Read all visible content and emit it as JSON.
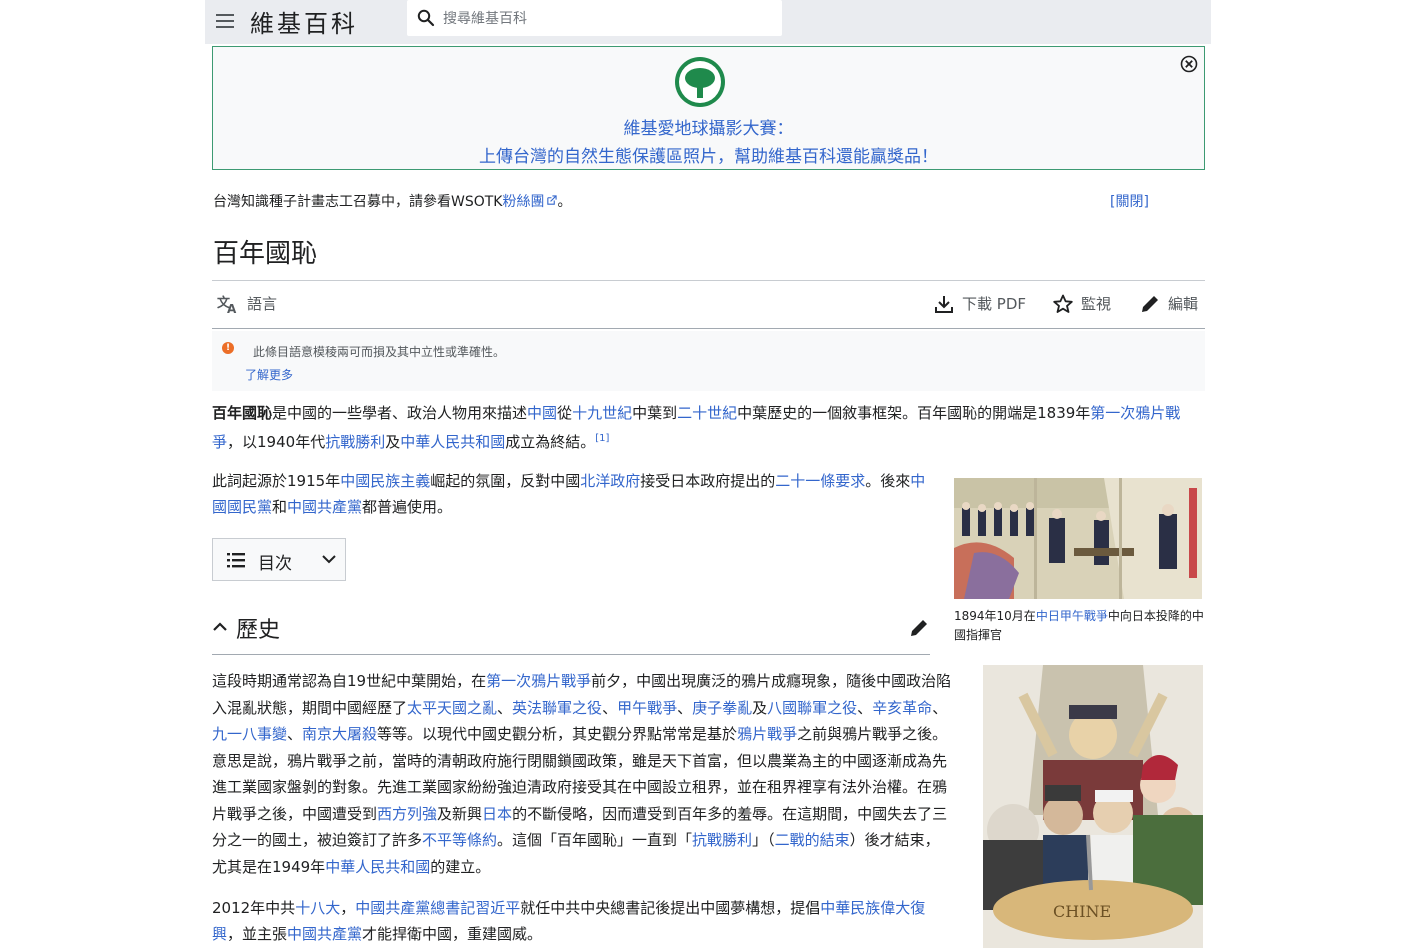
{
  "header": {
    "logo": "維基百科",
    "search_placeholder": "搜尋維基百科"
  },
  "banner": {
    "line1": "維基愛地球攝影大賽：",
    "line2": "上傳台灣的自然生態保護區照片，幫助維基百科還能贏獎品！"
  },
  "site_notice": {
    "text_before": "台灣知識種子計畫志工召募中，請參看WSOTK",
    "link": "粉絲團",
    "text_after": "。",
    "close_label": "[關閉]"
  },
  "page": {
    "title": "百年國恥"
  },
  "toolbar": {
    "language": "語言",
    "download": "下載 PDF",
    "watch": "監視",
    "edit": "編輯"
  },
  "warning": {
    "text": "此條目語意模稜兩可而損及其中立性或準確性。",
    "more": "了解更多"
  },
  "toc": {
    "label": "目次"
  },
  "section": {
    "heading": "歷史"
  },
  "figure1": {
    "caption_before": "1894年10月在",
    "caption_link": "中日甲午戰爭",
    "caption_after": "中向日本投降的中國指揮官"
  },
  "colors": {
    "link": "#3366cc",
    "banner_border": "#3d9a72",
    "header_bg": "#eaecf0",
    "warning_icon": "#ec6e27"
  },
  "paragraphs": {
    "p1": [
      {
        "t": "百年國恥",
        "b": true
      },
      {
        "t": "是中國的一些學者、政治人物用來描述"
      },
      {
        "t": "中國",
        "l": true
      },
      {
        "t": "從"
      },
      {
        "t": "十九世紀",
        "l": true
      },
      {
        "t": "中葉到"
      },
      {
        "t": "二十世紀",
        "l": true
      },
      {
        "t": "中葉歷史的一個敘事框架。百年國恥的開端是1839年"
      },
      {
        "t": "第一次鴉片戰爭",
        "l": true
      },
      {
        "t": "，以1940年代"
      },
      {
        "t": "抗戰勝利",
        "l": true
      },
      {
        "t": "及"
      },
      {
        "t": "中華人民共和國",
        "l": true
      },
      {
        "t": "成立為終結。"
      },
      {
        "t": "[1]",
        "l": true,
        "sup": true
      }
    ],
    "p2": [
      {
        "t": "此詞起源於1915年"
      },
      {
        "t": "中國民族主義",
        "l": true
      },
      {
        "t": "崛起的氛圍，反對中國"
      },
      {
        "t": "北洋政府",
        "l": true
      },
      {
        "t": "接受日本政府提出的"
      },
      {
        "t": "二十一條要求",
        "l": true
      },
      {
        "t": "。後來"
      },
      {
        "t": "中國國民黨",
        "l": true
      },
      {
        "t": "和"
      },
      {
        "t": "中國共產黨",
        "l": true
      },
      {
        "t": "都普遍使用。"
      }
    ],
    "p3": [
      {
        "t": "這段時期通常認為自19世紀中葉開始，在"
      },
      {
        "t": "第一次鴉片戰爭",
        "l": true
      },
      {
        "t": "前夕，中國出現廣泛的鴉片成癮現象，隨後中國政治陷入混亂狀態，期間中國經歷了"
      },
      {
        "t": "太平天國之亂",
        "l": true
      },
      {
        "t": "、"
      },
      {
        "t": "英法聯軍之役",
        "l": true
      },
      {
        "t": "、"
      },
      {
        "t": "甲午戰爭",
        "l": true
      },
      {
        "t": "、"
      },
      {
        "t": "庚子拳亂",
        "l": true
      },
      {
        "t": "及"
      },
      {
        "t": "八國聯軍之役",
        "l": true
      },
      {
        "t": "、"
      },
      {
        "t": "辛亥革命",
        "l": true
      },
      {
        "t": "、"
      },
      {
        "t": "九一八事變",
        "l": true
      },
      {
        "t": "、"
      },
      {
        "t": "南京大屠殺",
        "l": true
      },
      {
        "t": "等等。以現代中國史觀分析，其史觀分界點常常是基於"
      },
      {
        "t": "鴉片戰爭",
        "l": true
      },
      {
        "t": "之前與鴉片戰爭之後。意思是說，鴉片戰爭之前，當時的清朝政府施行閉關鎖國政策，雖是天下首富，但以農業為主的中國逐漸成為先進工業國家盤剝的對象。先進工業國家紛紛強迫清政府接受其在中國設立租界，並在租界裡享有法外治權。在鴉片戰爭之後，中國遭受到"
      },
      {
        "t": "西方列強",
        "l": true
      },
      {
        "t": "及新興"
      },
      {
        "t": "日本",
        "l": true
      },
      {
        "t": "的不斷侵略，因而遭受到百年多的羞辱。在這期間，中國失去了三分之一的國土，被迫簽訂了許多"
      },
      {
        "t": "不平等條約",
        "l": true
      },
      {
        "t": "。這個「百年國恥」一直到「"
      },
      {
        "t": "抗戰勝利",
        "l": true
      },
      {
        "t": "」（"
      },
      {
        "t": "二戰的結束",
        "l": true
      },
      {
        "t": "）後才結束，尤其是在1949年"
      },
      {
        "t": "中華人民共和國",
        "l": true
      },
      {
        "t": "的建立。"
      }
    ],
    "p4": [
      {
        "t": "2012年中共"
      },
      {
        "t": "十八大",
        "l": true
      },
      {
        "t": "，"
      },
      {
        "t": "中國共產黨總書記習近平",
        "l": true
      },
      {
        "t": "就任中共中央總書記後提出中國夢構想，提倡"
      },
      {
        "t": "中華民族偉大復興",
        "l": true
      },
      {
        "t": "，並主張"
      },
      {
        "t": "中國共產黨",
        "l": true
      },
      {
        "t": "才能捍衛中國，重建國威。"
      }
    ]
  }
}
